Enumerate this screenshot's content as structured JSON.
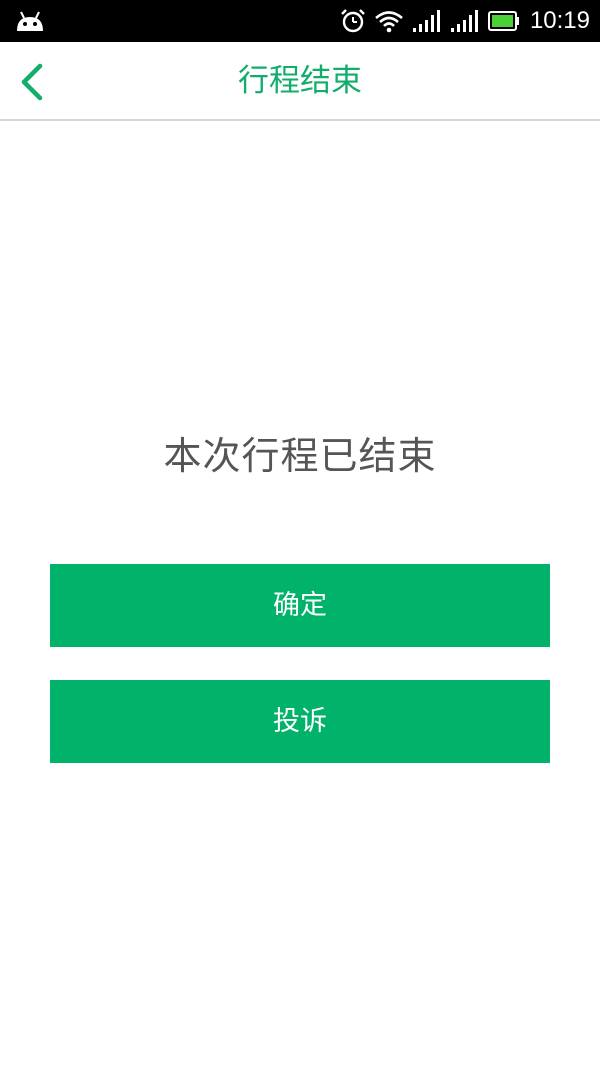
{
  "status_bar": {
    "time": "10:19",
    "icons": [
      "android-icon",
      "alarm-icon",
      "wifi-icon",
      "signal-icon",
      "signal-icon",
      "battery-icon"
    ]
  },
  "header": {
    "back_icon": "chevron-left-icon",
    "title": "行程结束"
  },
  "main": {
    "message": "本次行程已结束",
    "confirm_label": "确定",
    "complain_label": "投诉"
  },
  "colors": {
    "accent": "#00b26a",
    "title": "#12ad6a",
    "message": "#555555"
  }
}
